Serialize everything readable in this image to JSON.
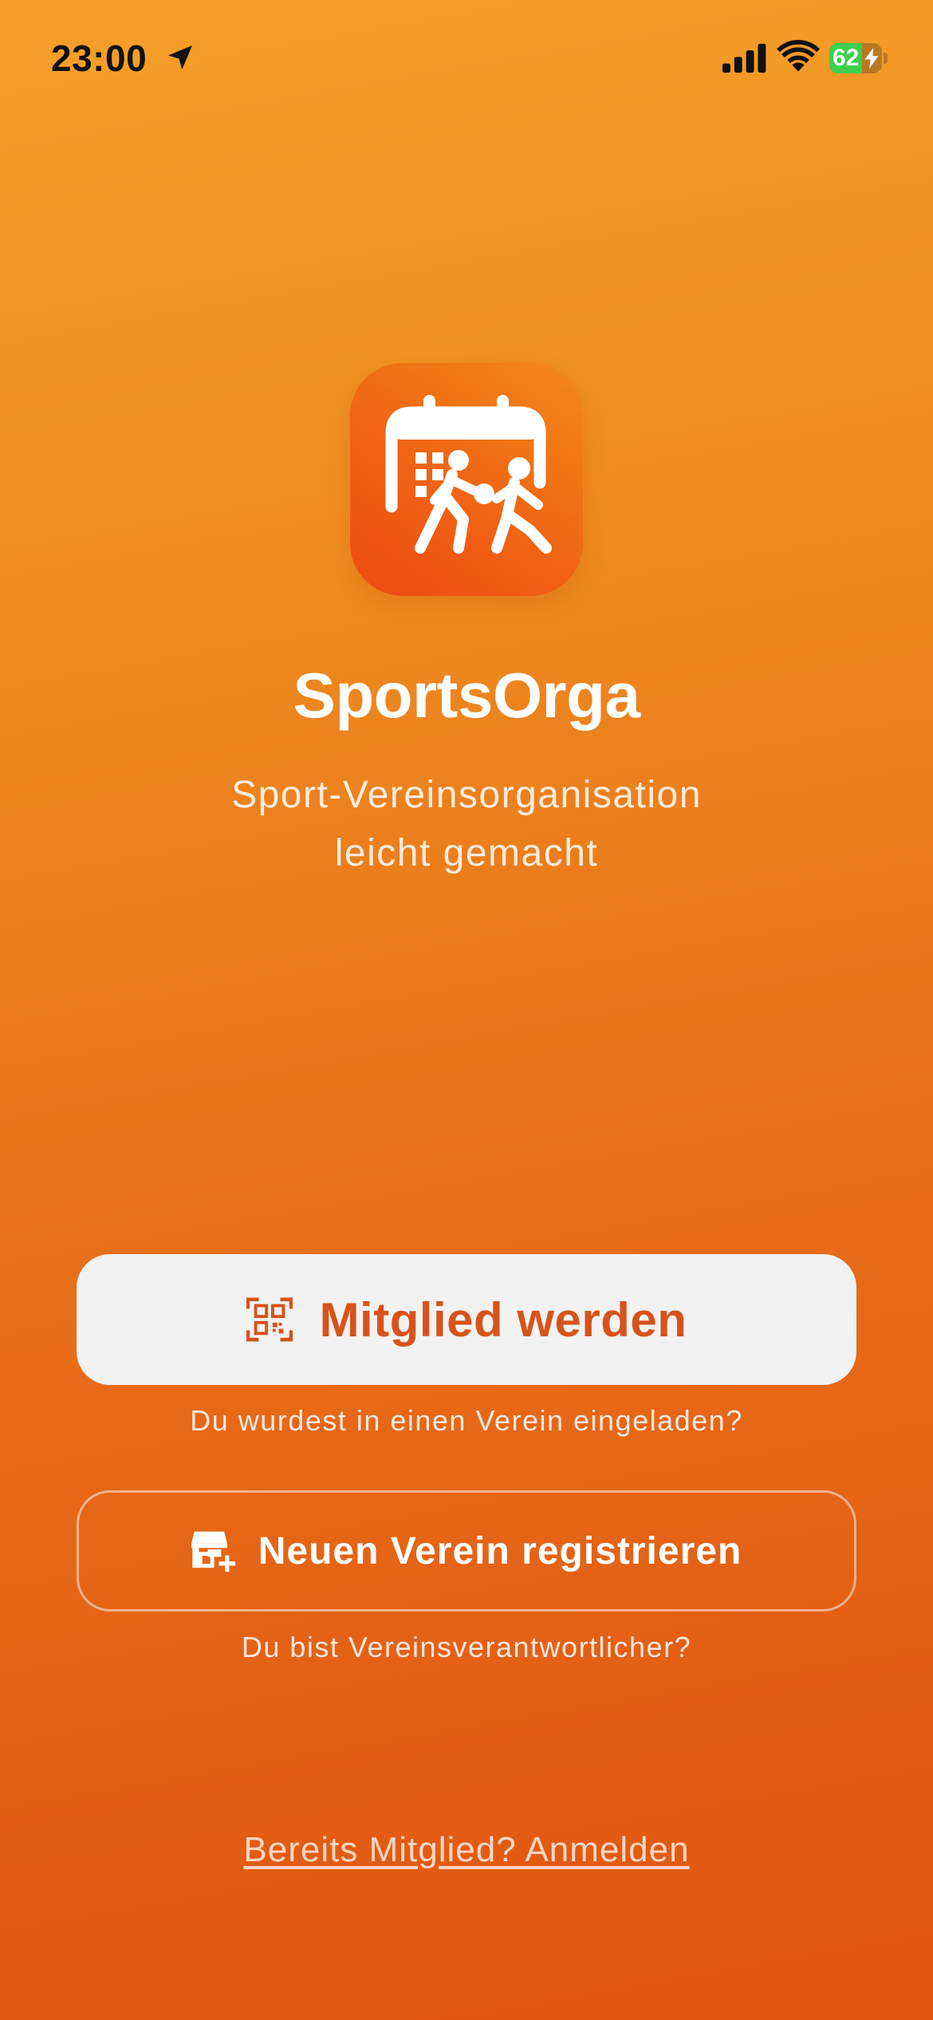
{
  "status_bar": {
    "time": "23:00",
    "battery_level": "62",
    "battery_fraction": 0.62,
    "location_icon": "location-arrow-icon",
    "signal_icon": "cellular-signal-icon",
    "wifi_icon": "wifi-icon",
    "battery_icon": "battery-charging-icon"
  },
  "app": {
    "icon": "calendar-sports-players-icon",
    "title": "SportsOrga",
    "subtitle_line1": "Sport-Vereinsorganisation",
    "subtitle_line2": "leicht gemacht"
  },
  "actions": {
    "join": {
      "icon": "qr-code-scan-icon",
      "label": "Mitglied werden",
      "hint": "Du wurdest in einen Verein eingeladen?"
    },
    "register": {
      "icon": "storefront-add-icon",
      "label": "Neuen Verein registrieren",
      "hint": "Du bist Vereinsverantwortlicher?"
    },
    "login_link": "Bereits Mitglied? Anmelden"
  },
  "colors": {
    "gradient_top": "#f5a02a",
    "gradient_bottom": "#df5410",
    "accent": "#d7531a",
    "primary_button_bg": "#f2f2f2",
    "text_light": "#ffffff",
    "battery_green": "#3ccf4e"
  }
}
